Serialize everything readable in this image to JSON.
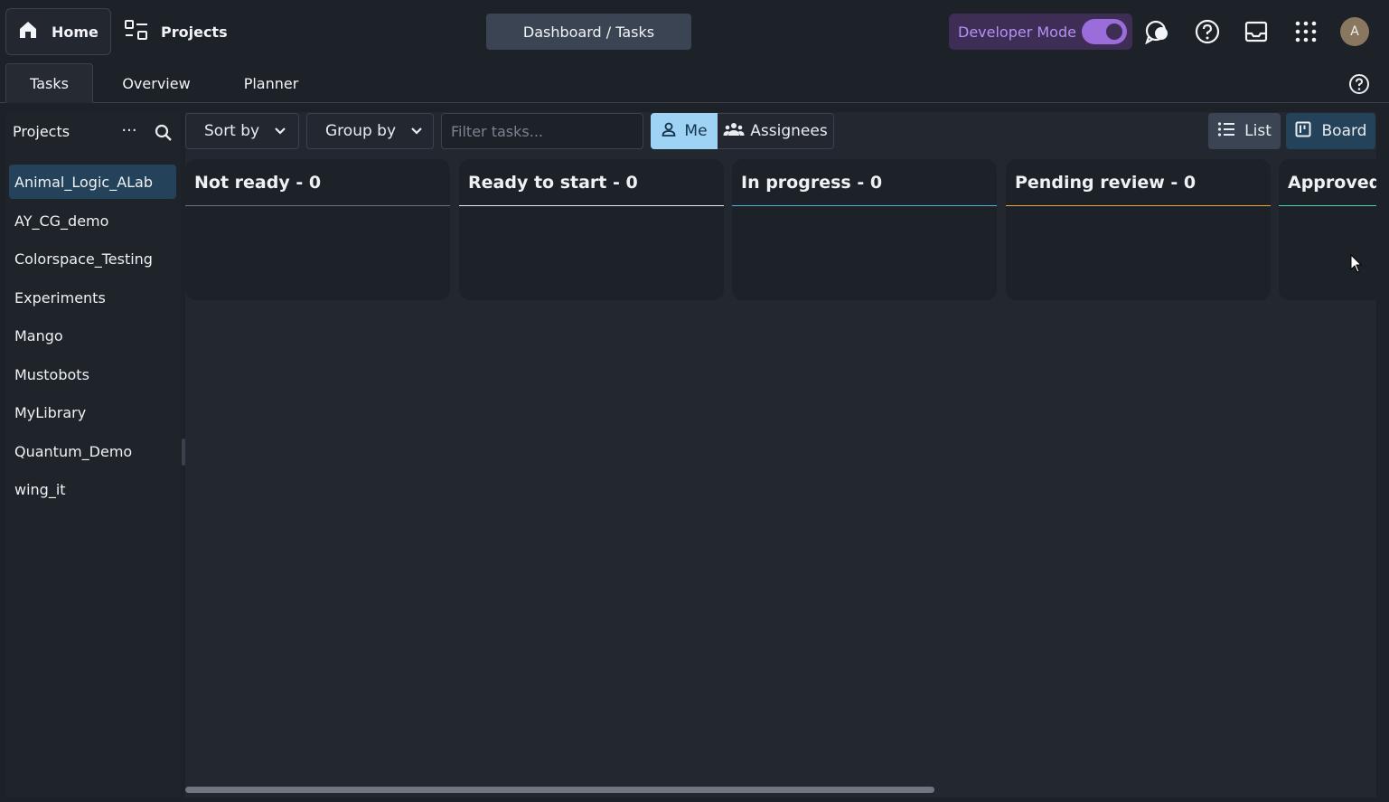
{
  "topbar": {
    "home_label": "Home",
    "projects_label": "Projects",
    "breadcrumb": "Dashboard / Tasks",
    "developer_mode_label": "Developer Mode",
    "developer_mode_on": true,
    "avatar_initial": "A"
  },
  "tabs": [
    {
      "label": "Tasks",
      "active": true
    },
    {
      "label": "Overview",
      "active": false
    },
    {
      "label": "Planner",
      "active": false
    }
  ],
  "sidebar": {
    "title": "Projects",
    "more_glyph": "···",
    "items": [
      {
        "label": "Animal_Logic_ALab",
        "selected": true
      },
      {
        "label": "AY_CG_demo",
        "selected": false
      },
      {
        "label": "Colorspace_Testing",
        "selected": false
      },
      {
        "label": "Experiments",
        "selected": false
      },
      {
        "label": "Mango",
        "selected": false
      },
      {
        "label": "Mustobots",
        "selected": false
      },
      {
        "label": "MyLibrary",
        "selected": false
      },
      {
        "label": "Quantum_Demo",
        "selected": false
      },
      {
        "label": "wing_it",
        "selected": false
      }
    ]
  },
  "toolbar": {
    "sort_label": "Sort by",
    "group_label": "Group by",
    "filter_placeholder": "Filter tasks...",
    "filter_value": "",
    "me_label": "Me",
    "assignees_label": "Assignees",
    "list_label": "List",
    "board_label": "Board"
  },
  "board": {
    "columns": [
      {
        "title": "Not ready - 0",
        "color": "#6b7280"
      },
      {
        "title": "Ready to start - 0",
        "color": "#e8ebef"
      },
      {
        "title": "In progress - 0",
        "color": "#4db3d9"
      },
      {
        "title": "Pending review - 0",
        "color": "#f2a13a"
      },
      {
        "title": "Approved -",
        "color": "#44d4b0"
      }
    ]
  },
  "colors": {
    "accent_selected": "#24435a",
    "me_active": "#9fd3f5",
    "developer_mode": "#b592f5"
  }
}
